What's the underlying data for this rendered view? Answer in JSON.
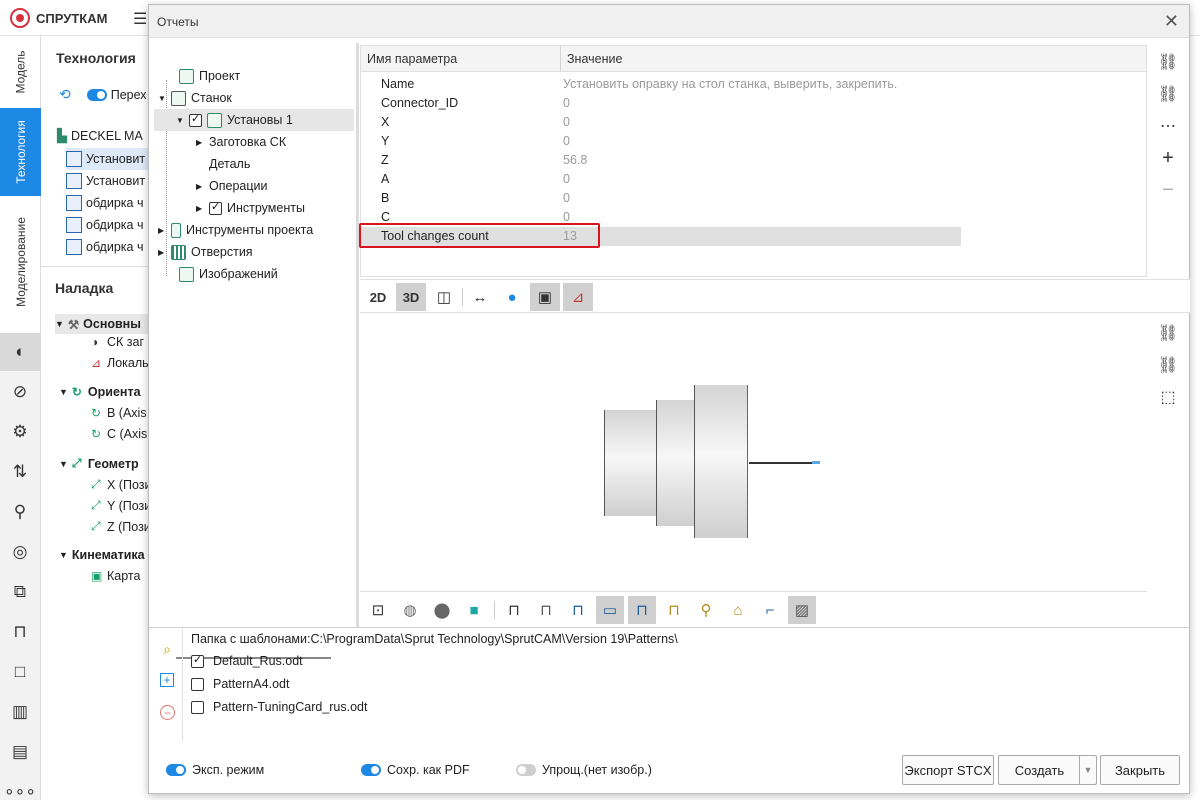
{
  "app": {
    "brand": "СПРУТКАМ",
    "vtabs": [
      "Модель",
      "Технология",
      "Моделирование"
    ],
    "panel": {
      "title": "Технология",
      "toggle_label": "Перех",
      "machine": "DECKEL MA",
      "ops": [
        "Установит",
        "Установит",
        "обдирка ч",
        "обдирка ч",
        "обдирка ч"
      ],
      "setup_title": "Наладка",
      "groups": [
        {
          "label": "Основны",
          "items": [
            "СК заг",
            "Локаль"
          ]
        },
        {
          "label": "Ориента",
          "items": [
            "B (Axis",
            "C (Axis"
          ]
        },
        {
          "label": "Геометр",
          "items": [
            "X (Пози",
            "Y (Пози",
            "Z (Пози"
          ]
        },
        {
          "label": "Кинематика",
          "items": [
            "Карта"
          ]
        }
      ]
    }
  },
  "dialog": {
    "title": "Отчеты",
    "tree": {
      "project": "Проект",
      "machine": "Станок",
      "setups": "Установы 1",
      "stock_cs": "Заготовка СК",
      "part": "Деталь",
      "operations": "Операции",
      "tools": "Инструменты",
      "project_tools": "Инструменты проекта",
      "holes": "Отверстия",
      "images": "Изображений"
    },
    "params": {
      "col_name": "Имя параметра",
      "col_value": "Значение",
      "rows": [
        {
          "name": "Name",
          "value": "Установить оправку на стол станка, выверить, закрепить."
        },
        {
          "name": "Connector_ID",
          "value": "0"
        },
        {
          "name": "X",
          "value": "0"
        },
        {
          "name": "Y",
          "value": "0"
        },
        {
          "name": "Z",
          "value": "56.8"
        },
        {
          "name": "A",
          "value": "0"
        },
        {
          "name": "B",
          "value": "0"
        },
        {
          "name": "C",
          "value": "0"
        },
        {
          "name": "Tool changes count",
          "value": "13"
        }
      ]
    },
    "viewer": {
      "btn_2d": "2D",
      "btn_3d": "3D"
    },
    "patterns": {
      "folder_label": "Папка с шаблонами:C:\\ProgramData\\Sprut Technology\\SprutCAM\\Version 19\\Patterns\\",
      "items": [
        {
          "name": "Default_Rus.odt",
          "checked": true
        },
        {
          "name": "PatternA4.odt",
          "checked": false
        },
        {
          "name": "Pattern-TuningCard_rus.odt",
          "checked": false
        }
      ]
    },
    "footer": {
      "exp_mode": "Эксп. режим",
      "save_pdf": "Сохр. как PDF",
      "simplified": "Упрощ.(нет изобр.)",
      "export_btn": "Экспорт STCX",
      "create_btn": "Создать",
      "close_btn": "Закрыть"
    },
    "colors": {
      "accent": "#1e88e5",
      "highlight_border": "#d7141c"
    }
  }
}
